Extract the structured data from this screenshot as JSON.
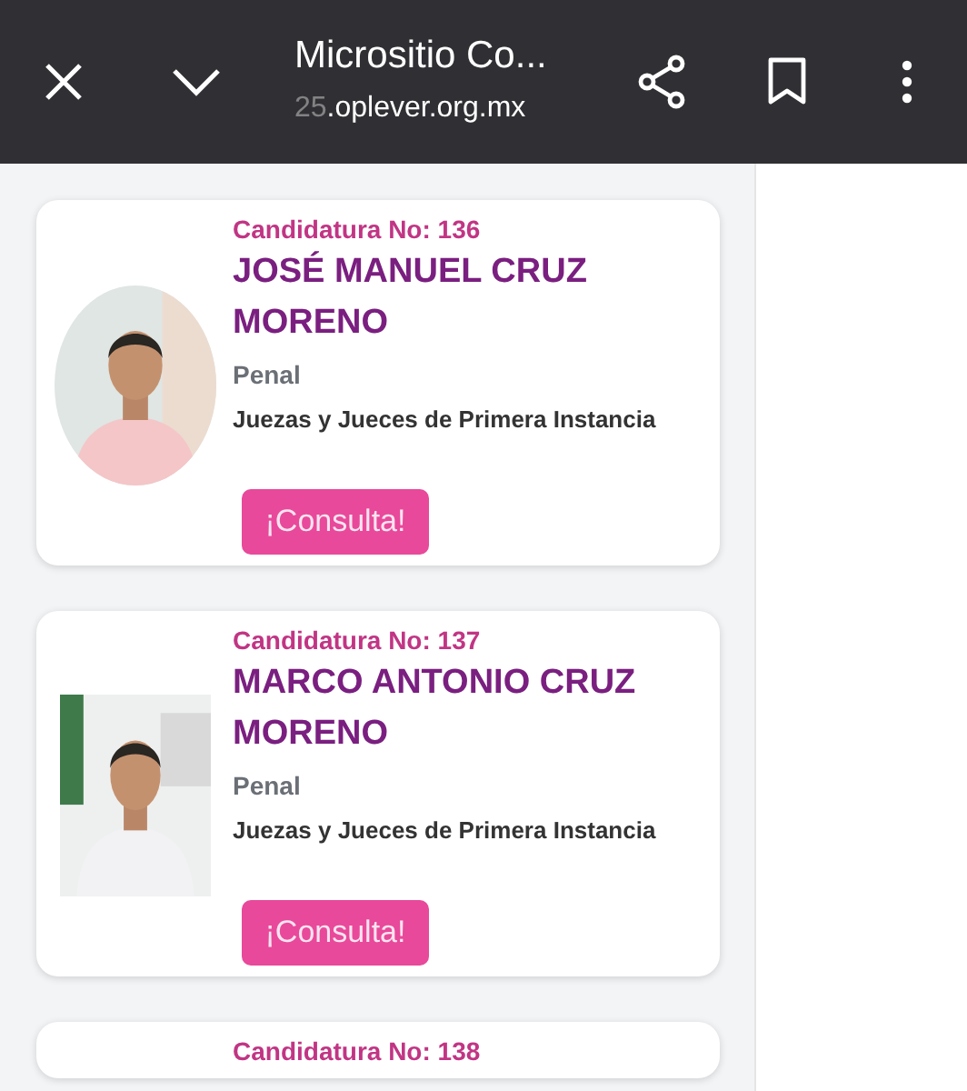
{
  "toolbar": {
    "title": "Micrositio Co...",
    "url_faded": "25",
    "url": ".oplever.org.mx"
  },
  "candidates": [
    {
      "label": "Candidatura No: 136",
      "name": "JOSÉ MANUEL CRUZ MORENO",
      "specialty": "Penal",
      "position": "Juezas y Jueces de Primera Instancia",
      "photo": {
        "kind": "oval"
      },
      "button": "¡Consulta!"
    },
    {
      "label": "Candidatura No: 137",
      "name": "MARCO ANTONIO CRUZ MORENO",
      "specialty": "Penal",
      "position": "Juezas y Jueces de Primera Instancia",
      "photo": {
        "kind": "rectangle"
      },
      "button": "¡Consulta!"
    },
    {
      "label": "Candidatura No: 138"
    }
  ]
}
